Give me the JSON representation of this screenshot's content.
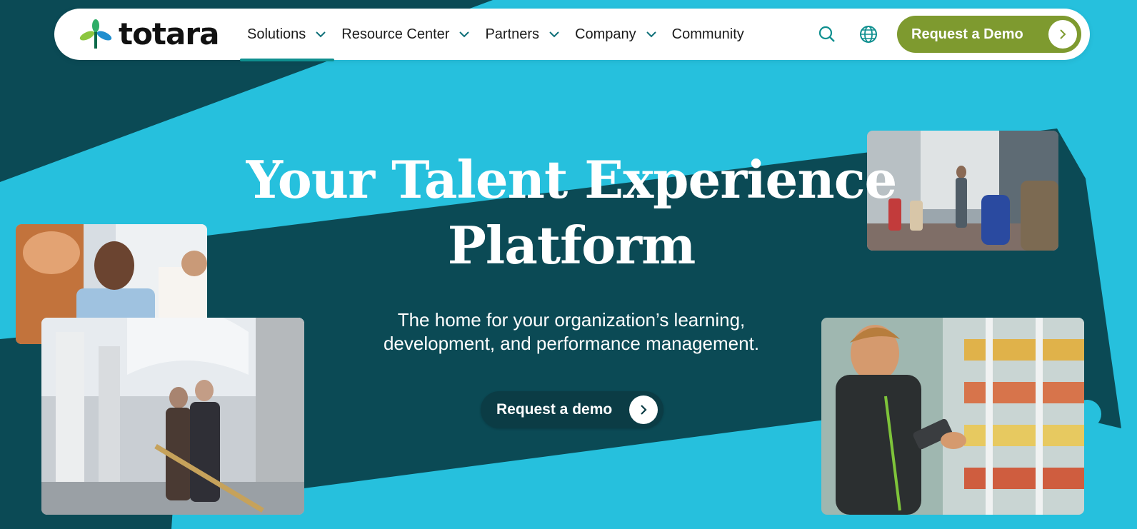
{
  "brand": {
    "logo_text": "totara"
  },
  "nav": {
    "items": [
      {
        "label": "Solutions",
        "has_dropdown": true,
        "active": true
      },
      {
        "label": "Resource Center",
        "has_dropdown": true,
        "active": false
      },
      {
        "label": "Partners",
        "has_dropdown": true,
        "active": false
      },
      {
        "label": "Company",
        "has_dropdown": true,
        "active": false
      },
      {
        "label": "Community",
        "has_dropdown": false,
        "active": false
      }
    ],
    "icons": [
      "search-icon",
      "globe-icon"
    ],
    "cta_label": "Request a Demo"
  },
  "hero": {
    "headline_line1": "Your Talent Experience",
    "headline_line2": "Platform",
    "subtitle_line1": "The home for your organization’s learning,",
    "subtitle_line2": "development, and performance management.",
    "cta_label": "Request a demo"
  },
  "photos": [
    "office-team-photo",
    "capitol-building-photo",
    "conference-presentation-photo",
    "grocery-scanner-photo"
  ],
  "colors": {
    "background_light": "#26c0dd",
    "background_dark": "#0b4a55",
    "cta_green": "#7e9a2f",
    "cta_dark": "#0b3c45",
    "text_white": "#ffffff"
  }
}
